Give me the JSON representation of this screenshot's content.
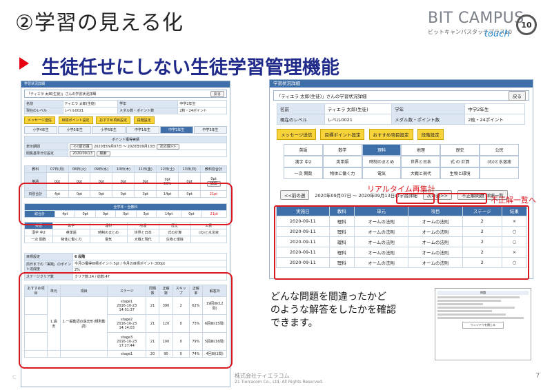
{
  "slide": {
    "title": "②学習の見える化",
    "subtitle": "生徒任せにしない生徒学習管理機能",
    "logo_main": "BIT CAMPUS",
    "logo_sub": "ビットキャンパスタッチプラス10",
    "logo_touch": "touch",
    "logo_badge": "10",
    "description_lines": [
      "どんな問題を間違ったかど",
      "のような解答をしたかを確認",
      "できます。"
    ],
    "callout_realtime": "リアルタイム再集計",
    "callout_incorrect": "不正解一覧へ",
    "footer_company": "株式会社ティエラコム",
    "footer_copy": "21  Tierracom Co., Ltd. All Rights Reserved.",
    "page_number": "7",
    "corner_c": "C"
  },
  "left_panel": {
    "bar_title": "学習状況詳細",
    "header_title": "「ティエラ 太郎(生徒)」さんの学習状況詳細",
    "back_label": "戻る",
    "name_label": "名前",
    "name_value": "ティエラ 太郎(生徒)",
    "grade_label": "学年",
    "grade_value": "中学2年生",
    "level_label": "現在のレベル",
    "level_value": "レベル0021",
    "medal_label": "メダル数・ポイント数",
    "medal_value": "2枚・24ポイント",
    "buttons": [
      "メッセージ送信",
      "目標ポイント設定",
      "おすすめ項目設定",
      "段階設定"
    ],
    "grade_tabs": [
      "小学4年生",
      "小学5年生",
      "小学6年生",
      "中学1年生",
      "中学2年生",
      "中学3年生"
    ],
    "points_title": "ポイント獲得実績",
    "period_label": "表示期間",
    "prev_week": "<<前の週",
    "period_text": "2020年09月07日 ～ 2020年09月13日",
    "next_week": "次の週>>",
    "start_label": "閲覧基準日付設定",
    "start_value": "2020/09/13",
    "search_label": "検索",
    "days": [
      "教科",
      "07日(月)",
      "08日(火)",
      "09日(水)",
      "10日(木)",
      "11日(金)",
      "12日(土)",
      "13日(日)",
      "教科別合計"
    ],
    "row_english": [
      "英語",
      "0pt",
      "0pt",
      "0pt",
      "0pt",
      "0pt",
      "0pt",
      "0pt",
      "0pt"
    ],
    "row_english_extra": "50%",
    "row_english_detail": "詳細",
    "row_total": [
      "日別合計",
      "4pt",
      "0pt",
      "0pt",
      "0pt",
      "3pt",
      "14pt",
      "0pt",
      "21pt"
    ],
    "summary_title": "全学年・全教科",
    "summary_row": [
      "総合計",
      "4pt",
      "0pt",
      "0pt",
      "0pt",
      "3pt",
      "14pt",
      "0pt",
      "21pt"
    ],
    "subjects_row1": [
      "英語",
      "数学",
      "理科",
      "地理",
      "歴史",
      "公民"
    ],
    "subjects_row2": [
      "漢字 中2",
      "英単語",
      "時制のまとめ",
      "世界と日本",
      "式の計算",
      "(わ)と水溶液"
    ],
    "subjects_row3": [
      "一次 関数",
      "物体に働く力",
      "電気",
      "大戦と現代",
      "生物と環境",
      ""
    ],
    "stage_label": "目標設定",
    "stage_value": "6 段階",
    "target_label": "前日までの「実践」のポイント達成度",
    "target_value": "今月の獲得目標ポイント:5pt  /  今月の目標ポイント:300pt",
    "percent_value": "2%",
    "clear_label": "ステージクリア数",
    "clear_value": "クリア数:24 / 総数:47",
    "detail_headers": [
      "おすすめ項目",
      "単元",
      "項目",
      "ステージ",
      "問題数",
      "正解数",
      "スキップ",
      "正解率",
      "解答日"
    ],
    "detail_rows": [
      [
        "",
        "1.過去",
        "1.一般動詞の過去形(規則動詞)",
        "stage1",
        "2016-10-23 14:01:37",
        "21",
        "390",
        "2",
        "62%",
        "19回目(12問)"
      ],
      [
        "",
        "",
        "",
        "stage2",
        "2016-10-23 14:14:03",
        "21",
        "120",
        "0",
        "73%",
        "6回目(15問)"
      ],
      [
        "",
        "",
        "",
        "stage3",
        "2016-10-23 17:27:44",
        "21",
        "100",
        "0",
        "79%",
        "5回目(16問)"
      ],
      [
        "",
        "",
        "",
        "stage1",
        "",
        "20",
        "90",
        "0",
        "74%",
        "4回目(1問)"
      ]
    ]
  },
  "right_panel": {
    "bar_title": "学習状況詳細",
    "header_title": "「ティエラ 太郎(生徒)」さんの学習状況詳細",
    "back_label": "戻る",
    "name_label": "名前",
    "name_value": "ティエラ 太郎(生徒)",
    "grade_label": "学年",
    "grade_value": "中学2年生",
    "level_label": "現在のレベル",
    "level_value": "レベル0021",
    "medal_label": "メダル数・ポイント数",
    "medal_value": "2枚・24ポイント",
    "buttons": [
      "メッセージ送信",
      "目標ポイント設定",
      "おすすめ項目設定",
      "段階設定"
    ],
    "subjects": [
      "英語",
      "数学",
      "理科",
      "地理",
      "歴史",
      "公民",
      "漢字 中2",
      "英単語",
      "時制のまとめ",
      "世界と日本",
      "式 の 計算",
      "(わ)と水溶液",
      "一次 関数",
      "物体に働く力",
      "電気",
      "大戦と現代",
      "生物と環境",
      ""
    ],
    "prev_week": "<<前の週",
    "week_text": "2020年09月07日 ～ 2020年09月13日の学習詳細",
    "next_week": "次の週>>",
    "incorrect_btn": "不正解問題 詳細一覧",
    "results_headers": [
      "実施日",
      "教科",
      "単元",
      "項目",
      "ステージ",
      "結果"
    ],
    "results": [
      [
        "2020-09-11",
        "理科",
        "オームの法則",
        "オームの法則",
        "2",
        "×"
      ],
      [
        "2020-09-11",
        "理科",
        "オームの法則",
        "オームの法則",
        "2",
        "○"
      ],
      [
        "2020-09-11",
        "理科",
        "オームの法則",
        "オームの法則",
        "2",
        "○"
      ],
      [
        "2020-09-11",
        "理科",
        "オームの法則",
        "オームの法則",
        "2",
        "×"
      ],
      [
        "2020-09-11",
        "理科",
        "オームの法則",
        "オームの法則",
        "2",
        "○"
      ]
    ]
  },
  "dialog": {
    "title": "問題",
    "footer": "ウィンドウを閉じる"
  }
}
